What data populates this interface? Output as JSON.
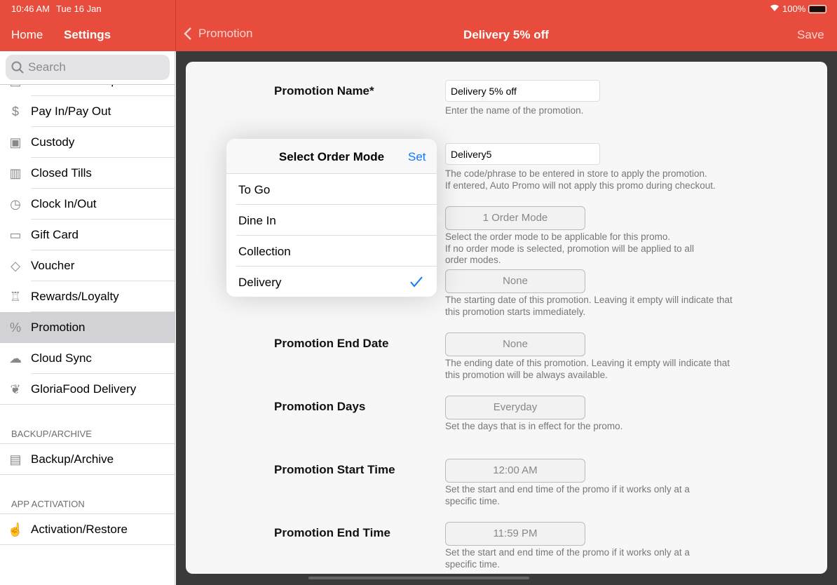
{
  "status": {
    "time": "10:46 AM",
    "date": "Tue 16 Jan",
    "battery": "100%"
  },
  "header": {
    "home": "Home",
    "settings": "Settings",
    "back": "Promotion",
    "title": "Delivery 5% off",
    "save": "Save"
  },
  "sidebar": {
    "search_placeholder": "Search",
    "items": [
      {
        "label": "Previous Receipts",
        "icon": "receipt-icon"
      },
      {
        "label": "Pay In/Pay Out",
        "icon": "cash-hand-icon"
      },
      {
        "label": "Custody",
        "icon": "custody-icon"
      },
      {
        "label": "Closed Tills",
        "icon": "register-icon"
      },
      {
        "label": "Clock In/Out",
        "icon": "clock-icon"
      },
      {
        "label": "Gift Card",
        "icon": "gift-card-icon"
      },
      {
        "label": "Voucher",
        "icon": "tag-icon"
      },
      {
        "label": "Rewards/Loyalty",
        "icon": "trophy-icon"
      },
      {
        "label": "Promotion",
        "icon": "percent-badge-icon",
        "selected": true
      },
      {
        "label": "Cloud Sync",
        "icon": "cloud-icon"
      },
      {
        "label": "GloriaFood Delivery",
        "icon": "leaf-icon"
      }
    ],
    "sections": [
      {
        "title": "BACKUP/ARCHIVE",
        "items": [
          {
            "label": "Backup/Archive",
            "icon": "backup-icon"
          }
        ]
      },
      {
        "title": "APP ACTIVATION",
        "items": [
          {
            "label": "Activation/Restore",
            "icon": "activation-icon"
          }
        ]
      }
    ]
  },
  "form": {
    "name": {
      "label": "Promotion Name*",
      "value": "Delivery 5% off",
      "hint": "Enter the name of the promotion."
    },
    "code": {
      "value": "Delivery5",
      "hint1": "The code/phrase to be entered in store to apply the promotion.",
      "hint2": "If entered, Auto Promo will not apply this promo during checkout."
    },
    "order_mode": {
      "value": "1 Order Mode",
      "hint1": "Select the order mode to be applicable for this promo.",
      "hint2": "If no order mode is selected, promotion will be applied to all",
      "hint3": "order modes."
    },
    "start_date": {
      "value": "None",
      "hint1": "The starting date of this promotion. Leaving it empty will indicate that",
      "hint2": "this promotion starts immediately."
    },
    "end_date": {
      "label": "Promotion End Date",
      "value": "None",
      "hint1": "The ending date of this promotion. Leaving it empty will indicate that",
      "hint2": "this promotion will be always available."
    },
    "days": {
      "label": "Promotion Days",
      "value": "Everyday",
      "hint": "Set the days that is in effect for the promo."
    },
    "start_time": {
      "label": "Promotion Start Time",
      "value": "12:00 AM",
      "hint1": "Set the start and end time of the promo if it works only at a",
      "hint2": "specific time."
    },
    "end_time": {
      "label": "Promotion End Time",
      "value": "11:59 PM",
      "hint1": "Set the start and end time of the promo if it works only at a",
      "hint2": "specific time."
    }
  },
  "popover": {
    "title": "Select Order Mode",
    "set": "Set",
    "options": [
      {
        "label": "To Go",
        "checked": false
      },
      {
        "label": "Dine In",
        "checked": false
      },
      {
        "label": "Collection",
        "checked": false
      },
      {
        "label": "Delivery",
        "checked": true
      }
    ],
    "accent": "#0a7aff"
  },
  "colors": {
    "brand": "#E84C3D",
    "accent": "#0a7aff"
  }
}
